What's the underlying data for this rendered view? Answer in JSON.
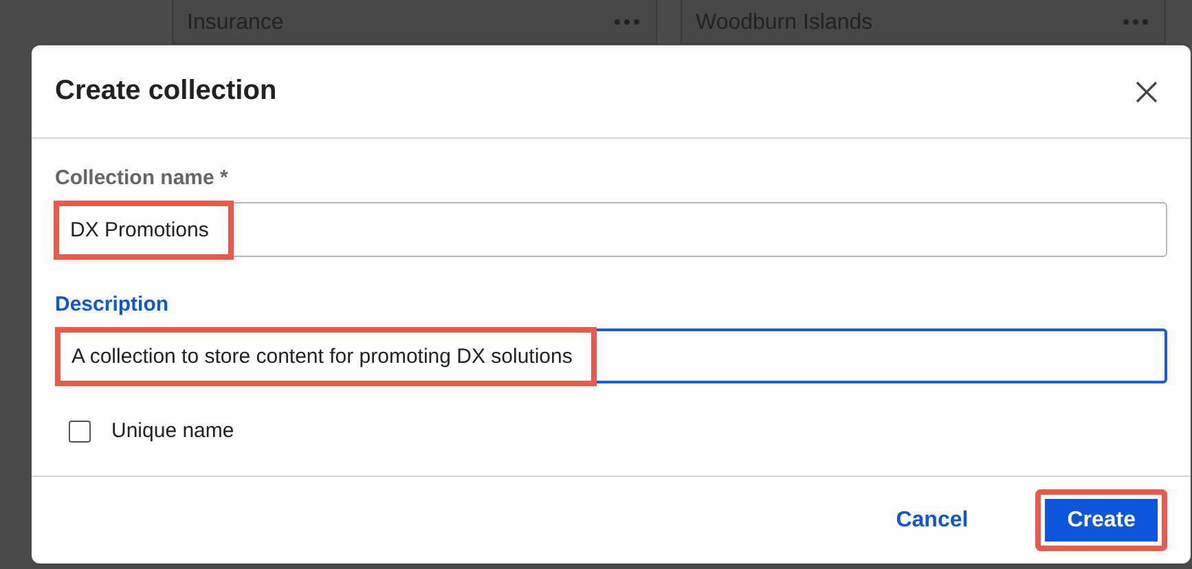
{
  "background_cards": [
    {
      "title": "Insurance"
    },
    {
      "title": "Woodburn Islands"
    }
  ],
  "dialog": {
    "title": "Create collection",
    "fields": [
      {
        "label": "Collection name *",
        "value": "DX Promotions",
        "focused": false,
        "highlighted": true
      },
      {
        "label": "Description",
        "value": "A collection to store content for promoting DX solutions",
        "focused": true,
        "highlighted": true
      }
    ],
    "checkbox": {
      "label": "Unique name",
      "checked": false
    },
    "buttons": [
      {
        "label": "Cancel",
        "kind": "link",
        "highlighted": false
      },
      {
        "label": "Create",
        "kind": "primary",
        "highlighted": true
      }
    ]
  }
}
